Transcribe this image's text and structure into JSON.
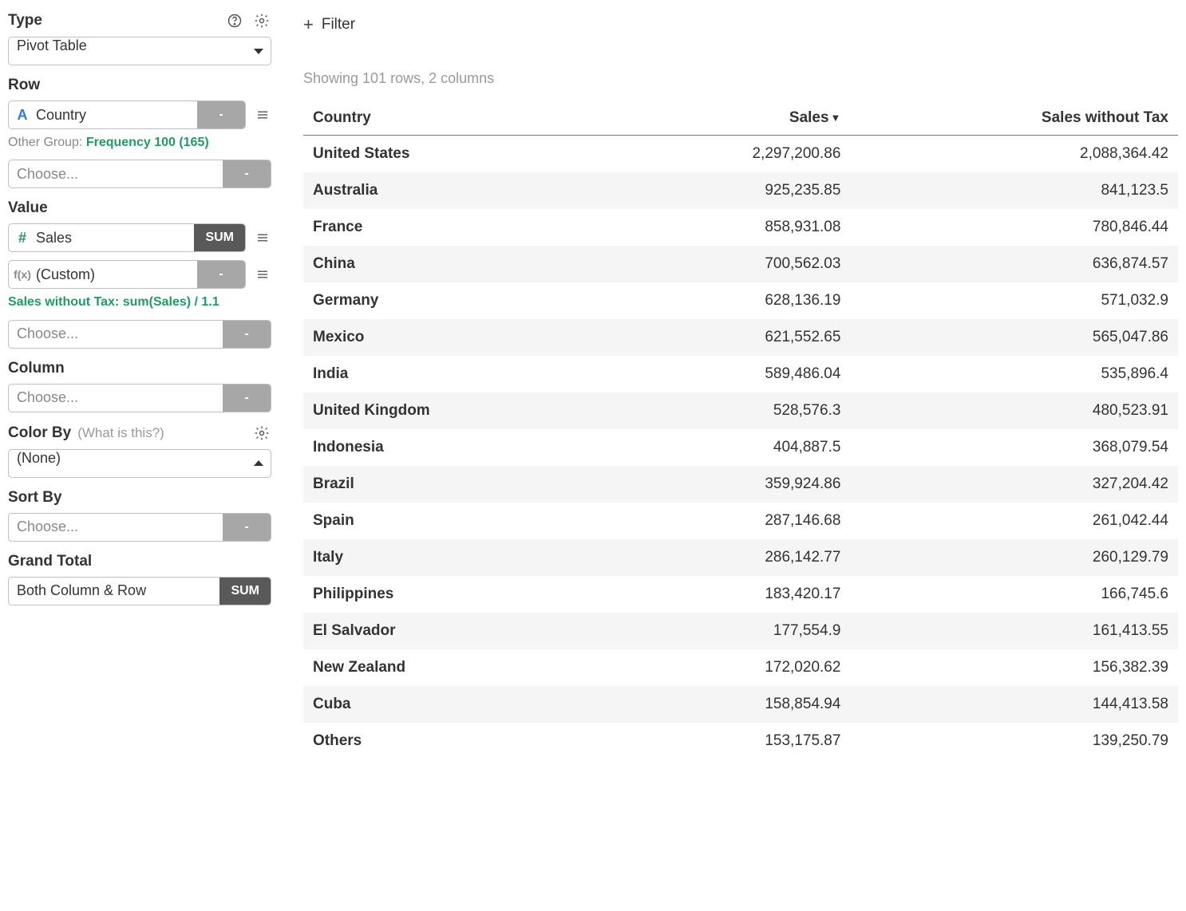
{
  "sidebar": {
    "type": {
      "label": "Type",
      "value": "Pivot Table"
    },
    "row": {
      "label": "Row",
      "field_icon": "A",
      "field": "Country",
      "agg": "-",
      "other_group_prefix": "Other Group: ",
      "other_group_value": "Frequency 100 (165)",
      "choose_placeholder": "Choose...",
      "choose_agg": "-"
    },
    "value": {
      "label": "Value",
      "field1_icon": "#",
      "field1_name": "Sales",
      "field1_agg": "SUM",
      "field2_icon": "f(x)",
      "field2_name": "(Custom)",
      "field2_agg": "-",
      "custom_expr": "Sales without Tax: sum(Sales) / 1.1",
      "choose_placeholder": "Choose...",
      "choose_agg": "-"
    },
    "column": {
      "label": "Column",
      "choose_placeholder": "Choose...",
      "choose_agg": "-"
    },
    "color_by": {
      "label": "Color By",
      "hint": "(What is this?)",
      "value": "(None)"
    },
    "sort_by": {
      "label": "Sort By",
      "choose_placeholder": "Choose...",
      "choose_agg": "-"
    },
    "grand_total": {
      "label": "Grand Total",
      "value": "Both Column & Row",
      "agg": "SUM"
    }
  },
  "main": {
    "filter_label": "Filter",
    "rows_info": "Showing 101 rows, 2 columns",
    "headers": {
      "c1": "Country",
      "c2": "Sales",
      "c3": "Sales without Tax"
    },
    "rows": [
      {
        "country": "United States",
        "sales": "2,297,200.86",
        "sales_no_tax": "2,088,364.42"
      },
      {
        "country": "Australia",
        "sales": "925,235.85",
        "sales_no_tax": "841,123.5"
      },
      {
        "country": "France",
        "sales": "858,931.08",
        "sales_no_tax": "780,846.44"
      },
      {
        "country": "China",
        "sales": "700,562.03",
        "sales_no_tax": "636,874.57"
      },
      {
        "country": "Germany",
        "sales": "628,136.19",
        "sales_no_tax": "571,032.9"
      },
      {
        "country": "Mexico",
        "sales": "621,552.65",
        "sales_no_tax": "565,047.86"
      },
      {
        "country": "India",
        "sales": "589,486.04",
        "sales_no_tax": "535,896.4"
      },
      {
        "country": "United Kingdom",
        "sales": "528,576.3",
        "sales_no_tax": "480,523.91"
      },
      {
        "country": "Indonesia",
        "sales": "404,887.5",
        "sales_no_tax": "368,079.54"
      },
      {
        "country": "Brazil",
        "sales": "359,924.86",
        "sales_no_tax": "327,204.42"
      },
      {
        "country": "Spain",
        "sales": "287,146.68",
        "sales_no_tax": "261,042.44"
      },
      {
        "country": "Italy",
        "sales": "286,142.77",
        "sales_no_tax": "260,129.79"
      },
      {
        "country": "Philippines",
        "sales": "183,420.17",
        "sales_no_tax": "166,745.6"
      },
      {
        "country": "El Salvador",
        "sales": "177,554.9",
        "sales_no_tax": "161,413.55"
      },
      {
        "country": "New Zealand",
        "sales": "172,020.62",
        "sales_no_tax": "156,382.39"
      },
      {
        "country": "Cuba",
        "sales": "158,854.94",
        "sales_no_tax": "144,413.58"
      },
      {
        "country": "Others",
        "sales": "153,175.87",
        "sales_no_tax": "139,250.79"
      }
    ]
  }
}
